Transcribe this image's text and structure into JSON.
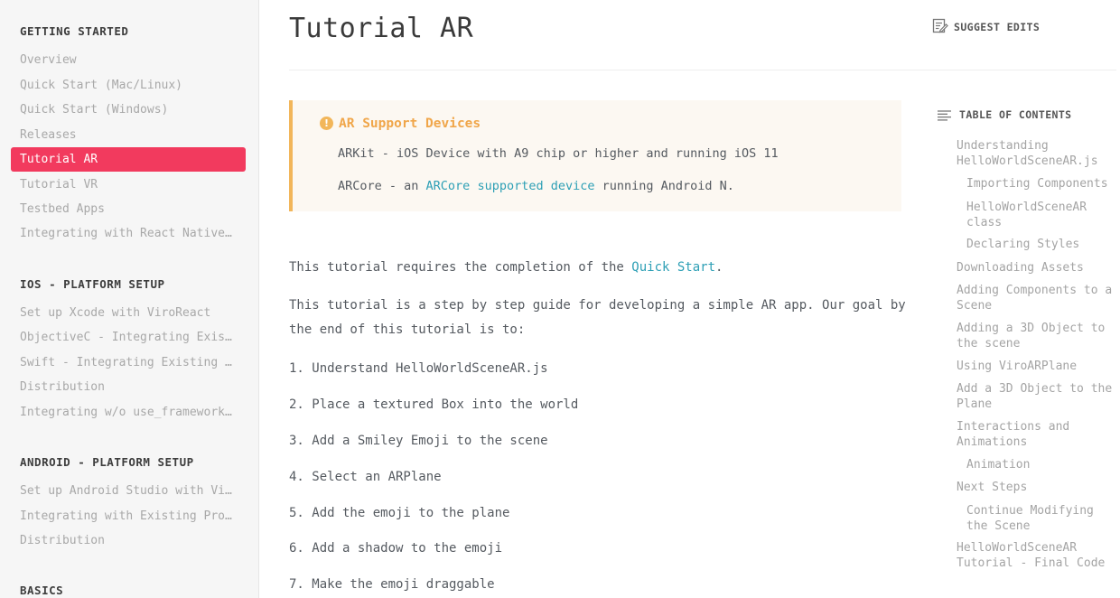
{
  "sidebar": {
    "sections": [
      {
        "title": "GETTING STARTED",
        "items": [
          "Overview",
          "Quick Start (Mac/Linux)",
          "Quick Start (Windows)",
          "Releases",
          "Tutorial AR",
          "Tutorial VR",
          "Testbed Apps",
          "Integrating with React Native Pr…"
        ]
      },
      {
        "title": "IOS - PLATFORM SETUP",
        "items": [
          "Set up Xcode with ViroReact",
          "ObjectiveC - Integrating Existin…",
          "Swift - Integrating Existing Pro…",
          "Distribution",
          "Integrating w/o use_frameworks! …"
        ]
      },
      {
        "title": "ANDROID - PLATFORM SETUP",
        "items": [
          "Set up Android Studio with ViroR…",
          "Integrating with Existing Projec…",
          "Distribution"
        ]
      },
      {
        "title": "BASICS",
        "items": []
      }
    ],
    "active_item": "Tutorial AR"
  },
  "page": {
    "title": "Tutorial AR",
    "suggest_edits": "SUGGEST EDITS"
  },
  "callout": {
    "title": "AR Support Devices",
    "line1": "ARKit - iOS Device with A9 chip or higher and running iOS 11",
    "line2_prefix": "ARCore - an ",
    "line2_link": "ARCore supported device",
    "line2_suffix": " running Android N."
  },
  "body": {
    "p1_prefix": "This tutorial requires the completion of the ",
    "p1_link": "Quick Start",
    "p1_suffix": ".",
    "p2_line1": "This tutorial is a step by step guide for developing a simple AR app. Our goal by",
    "p2_line2": "the end of this tutorial is to:",
    "steps": [
      "1. Understand HelloWorldSceneAR.js",
      "2. Place a textured Box into the world",
      "3. Add a Smiley Emoji to the scene",
      "4. Select an ARPlane",
      "5. Add the emoji to the plane",
      "6. Add a shadow to the emoji",
      "7. Make the emoji draggable"
    ]
  },
  "toc": {
    "header": "TABLE OF CONTENTS",
    "items": [
      {
        "label": "Understanding HelloWorldSceneAR.js",
        "level": 1
      },
      {
        "label": "Importing Components",
        "level": 2
      },
      {
        "label": "HelloWorldSceneAR class",
        "level": 2
      },
      {
        "label": "Declaring Styles",
        "level": 2
      },
      {
        "label": "Downloading Assets",
        "level": 1
      },
      {
        "label": "Adding Components to a Scene",
        "level": 1
      },
      {
        "label": "Adding a 3D Object to the scene",
        "level": 1
      },
      {
        "label": "Using ViroARPlane",
        "level": 1
      },
      {
        "label": "Add a 3D Object to the Plane",
        "level": 1
      },
      {
        "label": "Interactions and Animations",
        "level": 1
      },
      {
        "label": "Animation",
        "level": 2
      },
      {
        "label": "Next Steps",
        "level": 1
      },
      {
        "label": "Continue Modifying the Scene",
        "level": 2
      },
      {
        "label": "HelloWorldSceneAR Tutorial - Final Code",
        "level": 1
      }
    ]
  },
  "colors": {
    "accent": "#f23a5e",
    "link": "#2d9fb5",
    "warning": "#f2b65a"
  }
}
